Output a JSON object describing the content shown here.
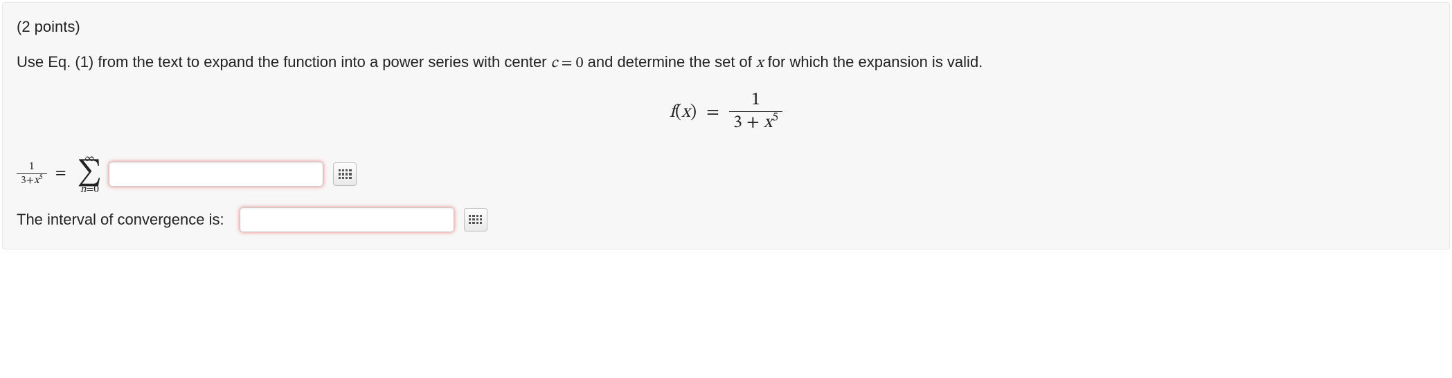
{
  "points_text": "(2 points)",
  "prompt_text_before_c": "Use Eq. (1) from the text to expand the function into a power series with center ",
  "prompt_c_equals": "c = 0",
  "prompt_text_after_c_before_x": " and determine the set of ",
  "prompt_var": "x",
  "prompt_text_after_x": " for which the expansion is valid.",
  "equation": {
    "lhs": "f(x)",
    "rhs_num": "1",
    "rhs_den_pre": "3 + ",
    "rhs_den_var": "x",
    "rhs_den_sup": "5"
  },
  "answer1": {
    "frac_num": "1",
    "frac_den_pre": "3+",
    "frac_den_var": "x",
    "frac_den_sup": "5",
    "sum_upper": "∞",
    "sum_lower": "n=0",
    "input_value": ""
  },
  "answer2": {
    "label": "The interval of convergence is:",
    "input_value": ""
  }
}
